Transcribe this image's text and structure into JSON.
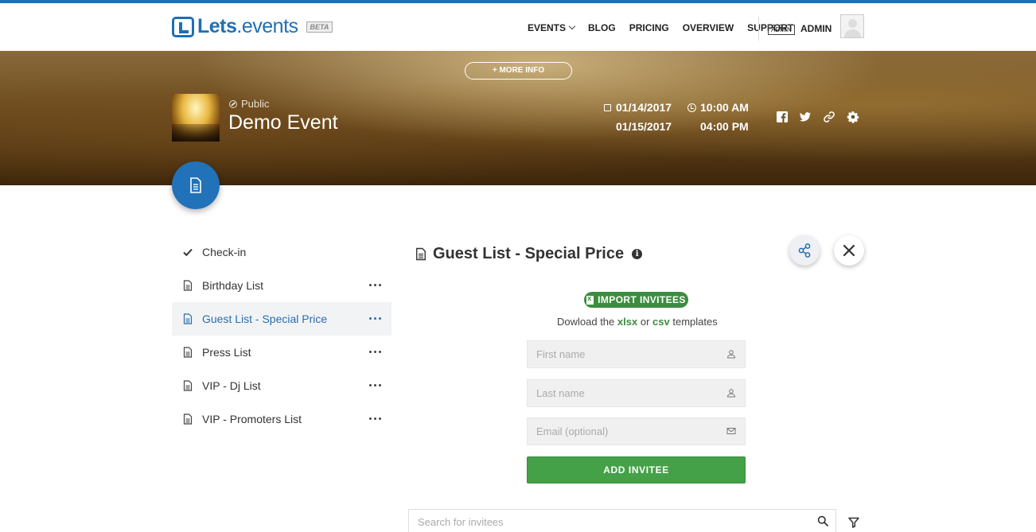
{
  "header": {
    "logo_bold": "Lets",
    "logo_light": ".events",
    "beta": "BETA",
    "nav": [
      {
        "label": "EVENTS",
        "has_dropdown": true
      },
      {
        "label": "BLOG"
      },
      {
        "label": "PRICING"
      },
      {
        "label": "OVERVIEW"
      },
      {
        "label": "SUPPORT"
      }
    ],
    "admin_badge": "ADMIN",
    "admin_name": "ADMIN"
  },
  "event": {
    "more_info": "+ MORE INFO",
    "visibility": "Public",
    "title": "Demo Event",
    "start_date": "01/14/2017",
    "end_date": "01/15/2017",
    "start_time": "10:00 AM",
    "end_time": "04:00 PM"
  },
  "sidebar": {
    "items": [
      {
        "label": "Check-in",
        "icon": "check-icon",
        "active": false,
        "menu": false
      },
      {
        "label": "Birthday List",
        "icon": "document-icon",
        "active": false,
        "menu": true
      },
      {
        "label": "Guest List - Special Price",
        "icon": "document-icon",
        "active": true,
        "menu": true
      },
      {
        "label": "Press List",
        "icon": "document-icon",
        "active": false,
        "menu": true
      },
      {
        "label": "VIP - Dj List",
        "icon": "document-icon",
        "active": false,
        "menu": true
      },
      {
        "label": "VIP - Promoters List",
        "icon": "document-icon",
        "active": false,
        "menu": true
      }
    ]
  },
  "main": {
    "list_title": "Guest List - Special Price",
    "import_label": "IMPORT INVITEES",
    "download_prefix": "Dowload the",
    "download_xlsx": "xlsx",
    "download_or": "or",
    "download_csv": "csv",
    "download_suffix": "templates",
    "first_name_placeholder": "First name",
    "last_name_placeholder": "Last name",
    "email_placeholder": "Email (optional)",
    "add_button": "ADD INVITEE",
    "search_placeholder": "Search for invitees"
  },
  "colors": {
    "brand_blue": "#1e6fb5",
    "active_blue": "#2a6db0",
    "green": "#44a148"
  }
}
